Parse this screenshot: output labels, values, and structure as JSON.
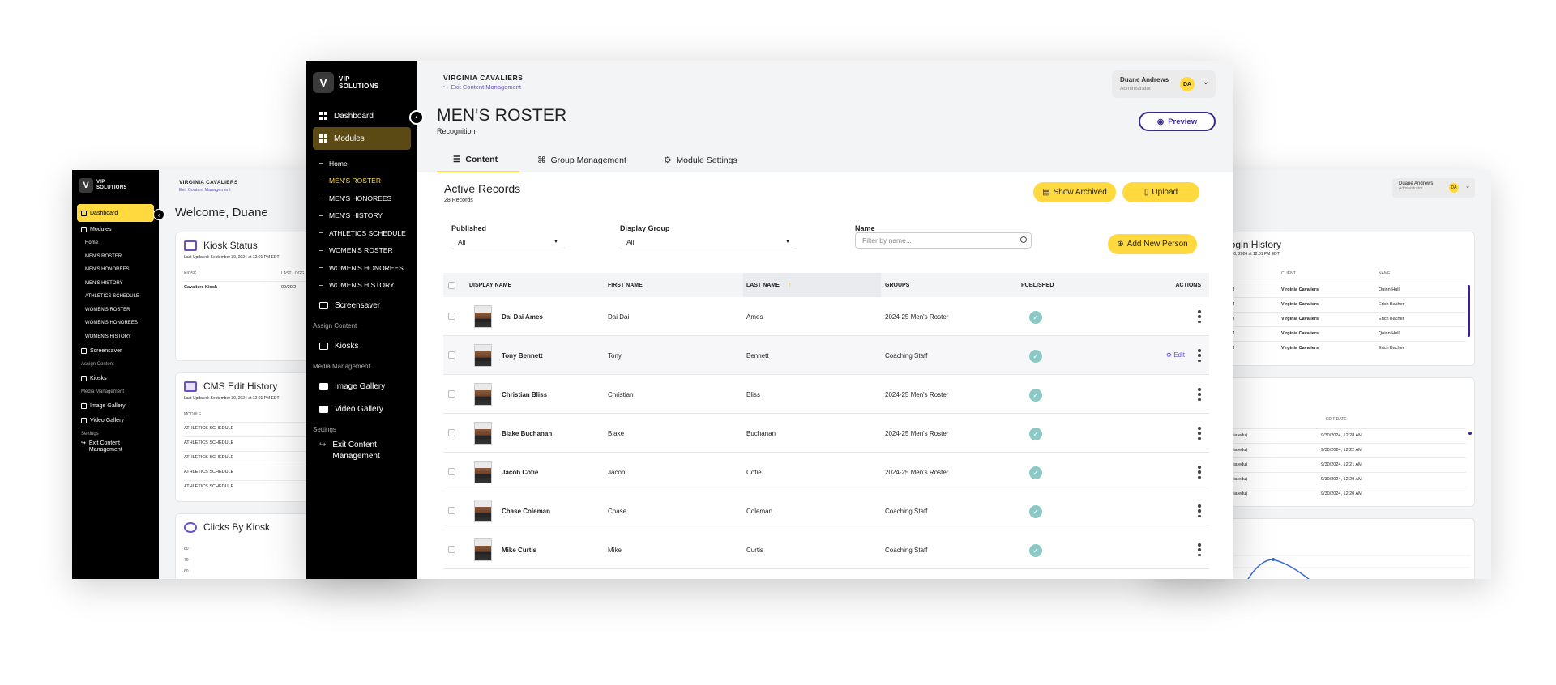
{
  "left_window": {
    "logo": {
      "mark": "V",
      "line1": "VIP",
      "line2": "SOLUTIONS"
    },
    "nav": [
      {
        "label": "Dashboard",
        "icon": "dashboard-icon",
        "active": true
      },
      {
        "label": "Modules",
        "icon": "grid-icon"
      }
    ],
    "sub": [
      "Home",
      "MEN'S ROSTER",
      "MEN'S HONOREES",
      "MEN'S HISTORY",
      "ATHLETICS SCHEDULE",
      "WOMEN'S ROSTER",
      "WOMEN'S HONOREES",
      "WOMEN'S HISTORY"
    ],
    "screensaver": "Screensaver",
    "assign_section": "Assign Content",
    "kiosks": "Kiosks",
    "media_section": "Media Management",
    "image_gallery": "Image Gallery",
    "video_gallery": "Video Gallery",
    "settings_section": "Settings",
    "exit1": "Exit Content",
    "exit2": "Management",
    "org": "VIRGINIA CAVALIERS",
    "exit_link": "Exit Content Management",
    "welcome": "Welcome, Duane",
    "kiosk_status": {
      "title": "Kiosk Status",
      "updated": "Last Updated: September 30, 2024 at 12:01 PM EDT",
      "col1": "KIOSK",
      "col2": "LAST LOGG",
      "row_name": "Cavaliers Kiosk",
      "row_date": "09/29/2"
    },
    "cms_history": {
      "title": "CMS Edit History",
      "updated": "Last Updated: September 30, 2024 at 12:01 PM EDT",
      "col1": "MODULE",
      "rows": [
        "ATHLETICS SCHEDULE",
        "ATHLETICS SCHEDULE",
        "ATHLETICS SCHEDULE",
        "ATHLETICS SCHEDULE",
        "ATHLETICS SCHEDULE"
      ]
    },
    "clicks": {
      "title": "Clicks By Kiosk",
      "ticks": [
        "80",
        "70",
        "60"
      ]
    }
  },
  "right_window": {
    "user_name": "Duane Andrews",
    "user_role": "Administrator",
    "avatar": "DA",
    "login": {
      "title": "Login History",
      "updated": "ber 30, 2024 at 12:01 PM EDT",
      "col_client": "CLIENT",
      "col_name": "NAME",
      "rows": [
        {
          "t": "PM",
          "client": "Virginia Cavaliers",
          "name": "Quinn Hull"
        },
        {
          "t": "AM",
          "client": "Virginia Cavaliers",
          "name": "Erich Bacher"
        },
        {
          "t": "AM",
          "client": "Virginia Cavaliers",
          "name": "Erich Bacher"
        },
        {
          "t": "PM",
          "client": "Virginia Cavaliers",
          "name": "Quinn Hull"
        },
        {
          "t": "AM",
          "client": "Virginia Cavaliers",
          "name": "Erich Bacher"
        }
      ]
    },
    "edits": {
      "col_date": "EDIT DATE",
      "rows": [
        {
          "user": "ginia.edu)",
          "date": "9/30/2024, 12:28 AM"
        },
        {
          "user": "ginia.edu)",
          "date": "9/30/2024, 12:22 AM"
        },
        {
          "user": "ginia.edu)",
          "date": "9/30/2024, 12:21 AM"
        },
        {
          "user": "ginia.edu)",
          "date": "9/30/2024, 12:20 AM"
        },
        {
          "user": "ginia.edu)",
          "date": "9/30/2024, 12:20 AM"
        }
      ]
    }
  },
  "main": {
    "logo": {
      "mark": "V",
      "line1": "VIP",
      "line2": "SOLUTIONS"
    },
    "sidebar": {
      "dashboard": "Dashboard",
      "modules": "Modules",
      "sub": [
        {
          "label": "Home",
          "current": false
        },
        {
          "label": "MEN'S ROSTER",
          "current": true
        },
        {
          "label": "MEN'S HONOREES",
          "current": false
        },
        {
          "label": "MEN'S HISTORY",
          "current": false
        },
        {
          "label": "ATHLETICS SCHEDULE",
          "current": false
        },
        {
          "label": "WOMEN'S ROSTER",
          "current": false
        },
        {
          "label": "WOMEN'S HONOREES",
          "current": false
        },
        {
          "label": "WOMEN'S HISTORY",
          "current": false
        }
      ],
      "screensaver": "Screensaver",
      "assign_section": "Assign Content",
      "kiosks": "Kiosks",
      "media_section": "Media Management",
      "image_gallery": "Image Gallery",
      "video_gallery": "Video Gallery",
      "settings_section": "Settings",
      "exit_line1": "Exit Content",
      "exit_line2": "Management"
    },
    "header": {
      "org": "VIRGINIA CAVALIERS",
      "exit_link": "Exit Content Management",
      "user_name": "Duane Andrews",
      "user_role": "Administrator",
      "avatar": "DA",
      "title": "MEN'S ROSTER",
      "subtitle": "Recognition",
      "preview": "Preview",
      "tabs": [
        "Content",
        "Group Management",
        "Module Settings"
      ]
    },
    "content": {
      "title": "Active Records",
      "count": "28 Records",
      "show_archived": "Show Archived",
      "upload": "Upload",
      "add_new": "Add New Person",
      "filters": {
        "published_label": "Published",
        "published_value": "All",
        "group_label": "Display Group",
        "group_value": "All",
        "name_label": "Name",
        "name_placeholder": "Filter by name..."
      },
      "columns": [
        "DISPLAY NAME",
        "FIRST NAME",
        "LAST NAME",
        "GROUPS",
        "PUBLISHED",
        "ACTIONS"
      ],
      "sort_indicator": "↑",
      "edit_label": "Edit",
      "rows": [
        {
          "display": "Dai Dai Ames",
          "first": "Dai Dai",
          "last": "Ames",
          "group": "2024-25 Men's Roster"
        },
        {
          "display": "Tony Bennett",
          "first": "Tony",
          "last": "Bennett",
          "group": "Coaching Staff"
        },
        {
          "display": "Christian Bliss",
          "first": "Christian",
          "last": "Bliss",
          "group": "2024-25 Men's Roster"
        },
        {
          "display": "Blake Buchanan",
          "first": "Blake",
          "last": "Buchanan",
          "group": "2024-25 Men's Roster"
        },
        {
          "display": "Jacob Cofie",
          "first": "Jacob",
          "last": "Cofie",
          "group": "2024-25 Men's Roster"
        },
        {
          "display": "Chase Coleman",
          "first": "Chase",
          "last": "Coleman",
          "group": "Coaching Staff"
        },
        {
          "display": "Mike Curtis",
          "first": "Mike",
          "last": "Curtis",
          "group": "Coaching Staff"
        }
      ]
    },
    "colors": {
      "accent_yellow": "#ffd93d",
      "purple": "#3b2a8c",
      "check": "#8cc8c4"
    }
  }
}
